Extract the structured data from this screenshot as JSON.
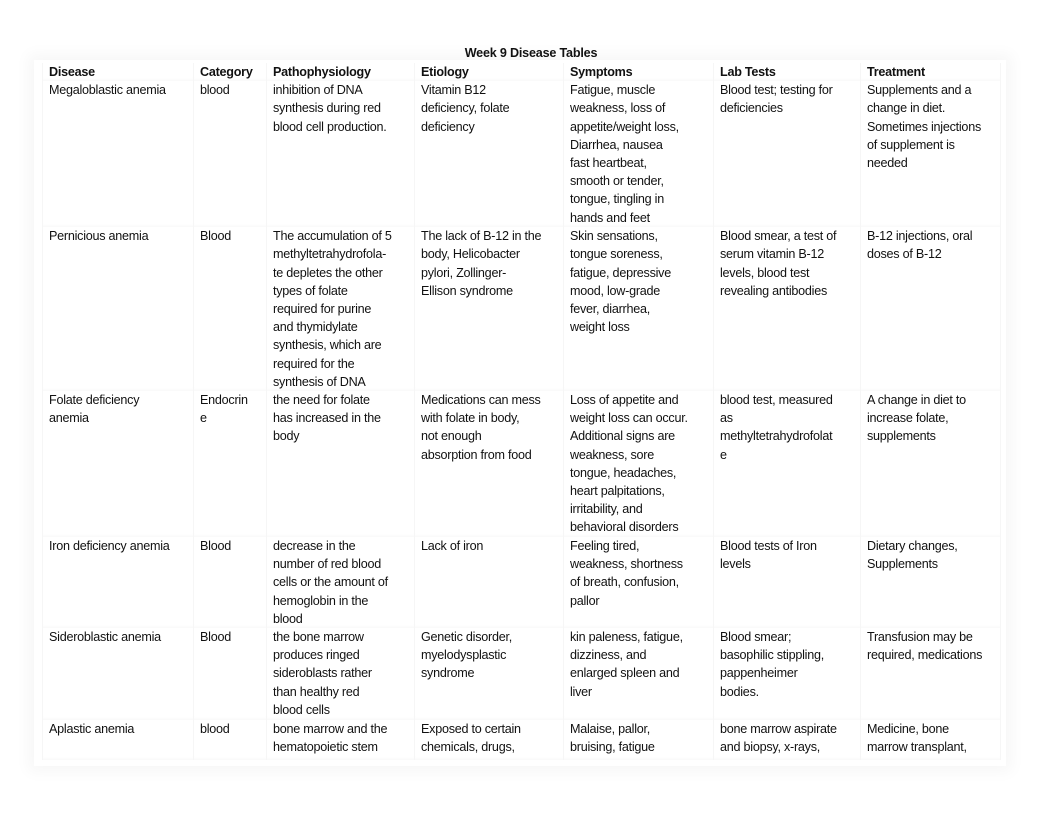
{
  "document": {
    "title": "Week 9 Disease Tables",
    "table": {
      "headers": [
        "Disease",
        "Category",
        "Pathophysiology",
        "Etiology",
        "Symptoms",
        "Lab Tests",
        "Treatment"
      ],
      "rows": [
        {
          "disease": "Megaloblastic anemia",
          "category": "blood",
          "pathophysiology": "inhibition of DNA\nsynthesis during red\nblood cell production.",
          "etiology": "Vitamin B12\ndeficiency, folate\ndeficiency",
          "symptoms": "Fatigue, muscle\nweakness, loss of\nappetite/weight loss,\nDiarrhea, nausea\nfast heartbeat,\nsmooth or tender,\ntongue, tingling in\nhands and feet",
          "lab_tests": "Blood test; testing for\ndeficiencies",
          "treatment": "Supplements and a\nchange in diet.\nSometimes injections\nof supplement is\nneeded"
        },
        {
          "disease": "Pernicious anemia",
          "category": "Blood",
          "pathophysiology": "The accumulation of 5\nmethyltetrahydrofola-\nte depletes the other\ntypes of folate\nrequired for purine\nand thymidylate\nsynthesis, which are\nrequired for the\nsynthesis of DNA",
          "etiology": "The lack of B-12 in the\nbody, Helicobacter\npylori, Zollinger-\nEllison syndrome",
          "symptoms": "Skin sensations,\ntongue soreness,\nfatigue, depressive\nmood, low-grade\nfever, diarrhea,\nweight loss",
          "lab_tests": "Blood smear, a test of\nserum vitamin B-12\nlevels, blood test\nrevealing antibodies",
          "treatment": "B-12 injections, oral\ndoses of B-12"
        },
        {
          "disease": "Folate deficiency\nanemia",
          "category": "Endocrin\ne",
          "pathophysiology": "the need for folate\nhas increased in the\nbody",
          "etiology": "Medications can mess\nwith folate in body,\nnot enough\nabsorption from food",
          "symptoms": "Loss of appetite and\nweight loss can occur.\nAdditional signs are\nweakness, sore\ntongue, headaches,\nheart palpitations,\nirritability, and\nbehavioral disorders",
          "lab_tests": "blood test, measured\nas\nmethyltetrahydrofolat\ne",
          "treatment": "A change in diet to\nincrease folate,\nsupplements"
        },
        {
          "disease": "Iron deficiency anemia",
          "category": "Blood",
          "pathophysiology": "decrease in the\nnumber of red blood\ncells or the amount of\nhemoglobin in the\nblood",
          "etiology": "Lack of iron",
          "symptoms": "Feeling tired,\nweakness, shortness\nof breath, confusion,\npallor",
          "lab_tests": "Blood tests of Iron\nlevels",
          "treatment": "Dietary changes,\nSupplements"
        },
        {
          "disease": "Sideroblastic anemia",
          "category": "Blood",
          "pathophysiology": "the bone marrow\nproduces ringed\nsideroblasts rather\nthan healthy red\nblood cells",
          "etiology": "Genetic disorder,\nmyelodysplastic\nsyndrome",
          "symptoms": "kin paleness, fatigue,\ndizziness, and\nenlarged spleen and\nliver",
          "lab_tests": "Blood smear;\nbasophilic stippling,\npappenheimer\nbodies.",
          "treatment": "Transfusion may be\nrequired, medications"
        },
        {
          "disease": "Aplastic anemia",
          "category": "blood",
          "pathophysiology": "bone marrow and the\nhematopoietic stem",
          "etiology": "Exposed to certain\nchemicals, drugs,",
          "symptoms": "Malaise, pallor,\nbruising, fatigue",
          "lab_tests": "bone marrow aspirate\nand biopsy, x-rays,",
          "treatment": "Medicine, bone\nmarrow transplant,"
        }
      ]
    }
  }
}
